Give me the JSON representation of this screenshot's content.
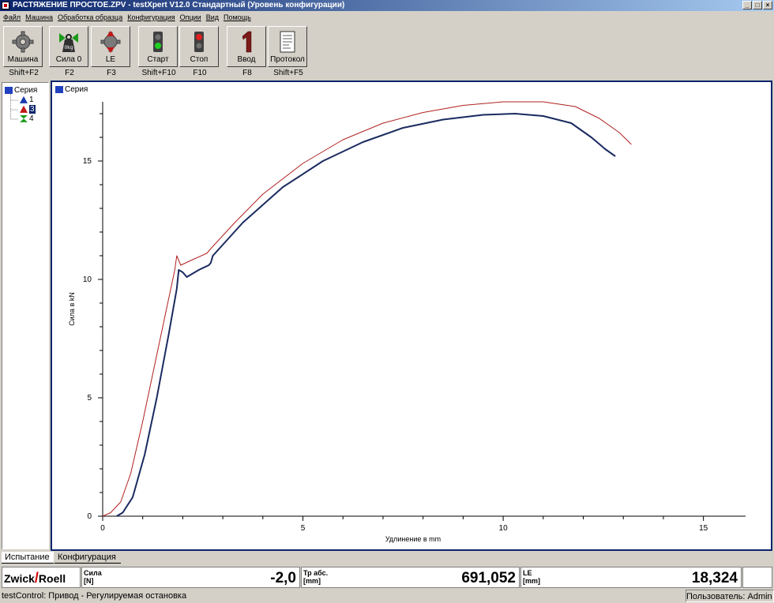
{
  "window": {
    "title": "РАСТЯЖЕНИЕ ПРОСТОЕ.ZPV - testXpert V12.0 Стандартный (Уровень конфигурации)",
    "min": "_",
    "max": "□",
    "close": "×"
  },
  "menu": [
    "Файл",
    "Машина",
    "Обработка образца",
    "Конфигурация",
    "Опции",
    "Вид",
    "Помощь"
  ],
  "toolbar": [
    {
      "label": "Машина",
      "key": "Shift+F2",
      "icon": "gear-icon"
    },
    {
      "label": "Сила 0",
      "key": "F2",
      "icon": "weight-icon"
    },
    {
      "label": "LE",
      "key": "F3",
      "icon": "gear-arrows-icon"
    },
    {
      "label": "Старт",
      "key": "Shift+F10",
      "icon": "traffic-light-green-icon"
    },
    {
      "label": "Стоп",
      "key": "F10",
      "icon": "traffic-light-red-icon"
    },
    {
      "label": "Ввод",
      "key": "F8",
      "icon": "number-one-icon"
    },
    {
      "label": "Протокол",
      "key": "Shift+F5",
      "icon": "document-icon"
    }
  ],
  "tree": {
    "root": "Серия",
    "items": [
      "1",
      "3",
      "4"
    ]
  },
  "chart_title": "Серия",
  "chart_data": {
    "type": "line",
    "xlabel": "Удлинение в mm",
    "ylabel": "Сила в kN",
    "xlim": [
      0,
      15.5
    ],
    "ylim": [
      0,
      17.5
    ],
    "xticks": [
      0,
      5,
      10,
      15
    ],
    "yticks": [
      0,
      5,
      10,
      15
    ],
    "grid": false,
    "series": [
      {
        "color": "#b02020",
        "points": [
          [
            0,
            0
          ],
          [
            0.2,
            0.15
          ],
          [
            0.45,
            0.6
          ],
          [
            0.7,
            1.8
          ],
          [
            1.0,
            4.0
          ],
          [
            1.3,
            6.4
          ],
          [
            1.6,
            8.8
          ],
          [
            1.8,
            10.4
          ],
          [
            1.85,
            11.0
          ],
          [
            1.95,
            10.6
          ],
          [
            2.2,
            10.8
          ],
          [
            2.6,
            11.1
          ],
          [
            2.7,
            11.3
          ],
          [
            3.3,
            12.4
          ],
          [
            4.0,
            13.6
          ],
          [
            5.0,
            14.9
          ],
          [
            6.0,
            15.9
          ],
          [
            7.0,
            16.6
          ],
          [
            8.0,
            17.05
          ],
          [
            9.0,
            17.35
          ],
          [
            10.0,
            17.5
          ],
          [
            11.0,
            17.5
          ],
          [
            11.8,
            17.3
          ],
          [
            12.4,
            16.8
          ],
          [
            12.9,
            16.2
          ],
          [
            13.2,
            15.7
          ]
        ]
      },
      {
        "color": "#1a2a60",
        "points": [
          [
            0.35,
            0
          ],
          [
            0.5,
            0.15
          ],
          [
            0.75,
            0.8
          ],
          [
            1.05,
            2.6
          ],
          [
            1.35,
            5.0
          ],
          [
            1.65,
            7.7
          ],
          [
            1.85,
            9.6
          ],
          [
            1.9,
            10.4
          ],
          [
            2.0,
            10.3
          ],
          [
            2.1,
            10.1
          ],
          [
            2.4,
            10.4
          ],
          [
            2.65,
            10.6
          ],
          [
            2.7,
            10.7
          ],
          [
            2.75,
            11.0
          ],
          [
            3.5,
            12.4
          ],
          [
            4.5,
            13.9
          ],
          [
            5.5,
            15.0
          ],
          [
            6.5,
            15.8
          ],
          [
            7.5,
            16.4
          ],
          [
            8.5,
            16.75
          ],
          [
            9.5,
            16.95
          ],
          [
            10.3,
            17.0
          ],
          [
            11.0,
            16.9
          ],
          [
            11.7,
            16.6
          ],
          [
            12.2,
            16.0
          ],
          [
            12.55,
            15.5
          ],
          [
            12.8,
            15.2
          ]
        ]
      }
    ]
  },
  "tabs": [
    "Испытание",
    "Конфигурация"
  ],
  "logo": {
    "left": "Zwick",
    "slash": "/",
    "right": "Roell"
  },
  "readouts": [
    {
      "label1": "Сила",
      "label2": "[N]",
      "value": "-2,0"
    },
    {
      "label1": "Тр абс.",
      "label2": "[mm]",
      "value": "691,052"
    },
    {
      "label1": "LE",
      "label2": "[mm]",
      "value": "18,324"
    }
  ],
  "status": {
    "left": "testControl: Привод - Регулируемая остановка",
    "right": "Пользователь: Admin"
  }
}
